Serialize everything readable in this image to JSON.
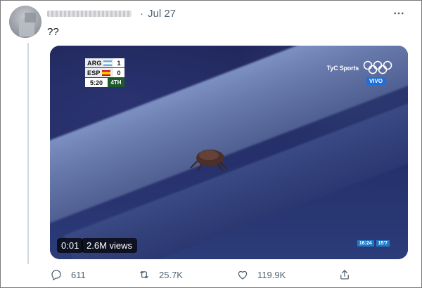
{
  "tweet": {
    "author_name_redacted": true,
    "separator": "·",
    "date": "Jul 27",
    "text": "??",
    "more_icon": "more-horizontal-icon"
  },
  "media": {
    "elapsed": "0:01",
    "views": "2.6M views",
    "scoreboard": {
      "teams": [
        {
          "code": "ARG",
          "score": "1",
          "flag": "argentina-flag"
        },
        {
          "code": "ESP",
          "score": "0",
          "flag": "spain-flag"
        }
      ],
      "clock": "5:20",
      "period": "4TH"
    },
    "broadcaster": "TyC Sports",
    "live_label": "VIVO",
    "corner_clock": [
      "16:24",
      "15'7"
    ]
  },
  "actions": {
    "reply": {
      "icon": "reply-icon",
      "count": "611"
    },
    "retweet": {
      "icon": "retweet-icon",
      "count": "25.7K"
    },
    "like": {
      "icon": "heart-icon",
      "count": "119.9K"
    },
    "share": {
      "icon": "share-icon"
    }
  },
  "colors": {
    "secondary_text": "#536471",
    "thread_line": "#cfd9de",
    "live_blue": "#1e6fd9"
  }
}
